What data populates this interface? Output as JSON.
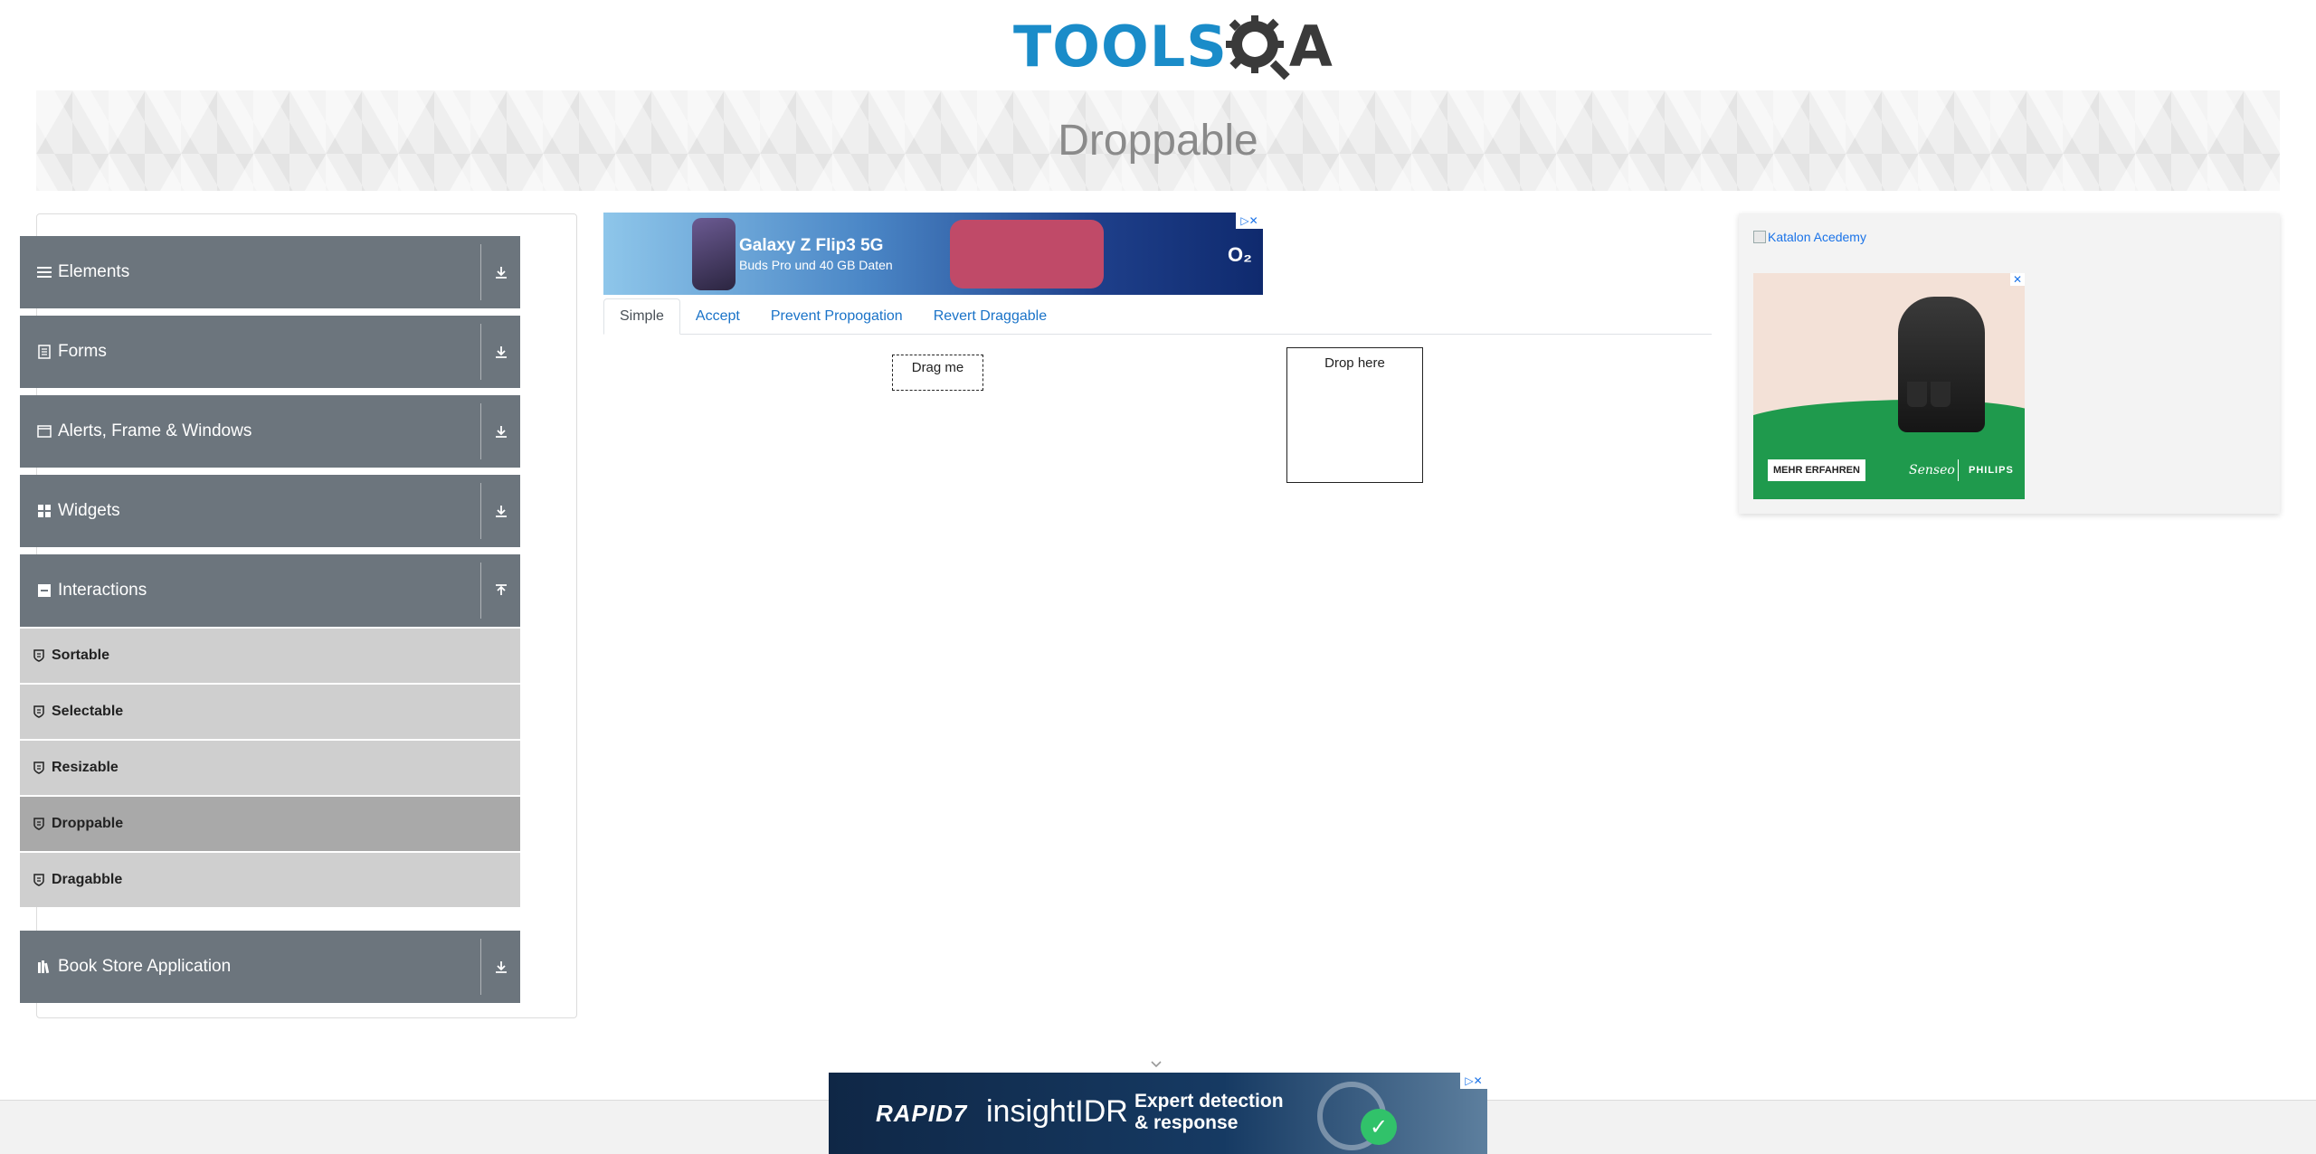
{
  "brand": {
    "logo_main": "TOOLS",
    "logo_suffix": "A",
    "logo_color": "#1a8cc9"
  },
  "page": {
    "title": "Droppable"
  },
  "sidebar": {
    "groups": [
      {
        "label": "Elements",
        "icon": "hamburger-icon",
        "toggle_icon": "download-arrow-icon"
      },
      {
        "label": "Forms",
        "icon": "document-icon",
        "toggle_icon": "download-arrow-icon"
      },
      {
        "label": "Alerts, Frame & Windows",
        "icon": "window-icon",
        "toggle_icon": "download-arrow-icon"
      },
      {
        "label": "Widgets",
        "icon": "grid-icon",
        "toggle_icon": "download-arrow-icon"
      },
      {
        "label": "Interactions",
        "icon": "interactions-icon",
        "toggle_icon": "upload-arrow-icon"
      },
      {
        "label": "Book Store Application",
        "icon": "books-icon",
        "toggle_icon": "download-arrow-icon"
      }
    ],
    "interactions_items": [
      {
        "label": "Sortable",
        "active": false
      },
      {
        "label": "Selectable",
        "active": false
      },
      {
        "label": "Resizable",
        "active": false
      },
      {
        "label": "Droppable",
        "active": true
      },
      {
        "label": "Dragabble",
        "active": false
      }
    ]
  },
  "ad_top": {
    "title": "Galaxy Z Flip3 5G",
    "subtitle": "Buds Pro und 40 GB Daten",
    "brand": "O₂",
    "close": "▷✕"
  },
  "tabs": [
    {
      "label": "Simple",
      "active": true
    },
    {
      "label": "Accept",
      "active": false
    },
    {
      "label": "Prevent Propogation",
      "active": false
    },
    {
      "label": "Revert Draggable",
      "active": false
    }
  ],
  "draggable": {
    "label": "Drag me"
  },
  "droppable": {
    "label": "Drop here"
  },
  "ad_right": {
    "katalon_alt": "Katalon Acedemy",
    "button": "MEHR ERFAHREN",
    "brand_a": "Senseo",
    "brand_b": "PHILIPS",
    "close": "✕"
  },
  "ad_bottom": {
    "brand": "RAPID7",
    "product": "insightIDR",
    "headline_1": "Expert detection",
    "headline_2": "& response",
    "close": "▷✕",
    "check": "✓"
  }
}
